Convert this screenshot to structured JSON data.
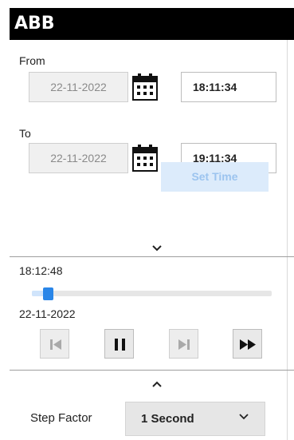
{
  "header": {
    "logo": "ABB"
  },
  "from": {
    "label": "From",
    "date": "22-11-2022",
    "time": "18:11:34"
  },
  "to": {
    "label": "To",
    "date": "22-11-2022",
    "time": "19:11:34"
  },
  "set_time_label": "Set Time",
  "playback": {
    "current_time": "18:12:48",
    "current_date": "22-11-2022",
    "progress": 0.06
  },
  "controls": [
    {
      "name": "skip-to-start",
      "icon": "skip-start-icon",
      "enabled": false
    },
    {
      "name": "pause",
      "icon": "pause-icon",
      "enabled": true
    },
    {
      "name": "step-forward",
      "icon": "step-forward-icon",
      "enabled": false
    },
    {
      "name": "fast-forward",
      "icon": "fast-forward-icon",
      "enabled": true
    }
  ],
  "step_factor": {
    "label": "Step Factor",
    "value": "1 Second"
  },
  "colors": {
    "accent": "#2a86e8",
    "header": "#000000",
    "disabled_button": "#dcebfb"
  }
}
